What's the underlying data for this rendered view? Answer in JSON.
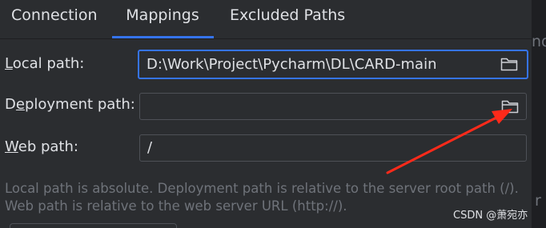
{
  "tabs": [
    {
      "label": "Connection"
    },
    {
      "label": "Mappings"
    },
    {
      "label": "Excluded Paths"
    }
  ],
  "active_tab": "Mappings",
  "form": {
    "local_path": {
      "label_mnemonic": "L",
      "label_rest": "ocal path:",
      "value": "D:\\Work\\Project\\Pycharm\\DL\\CARD-main"
    },
    "deployment_path": {
      "label_pre": "D",
      "label_mnemonic": "e",
      "label_rest": "ployment path:",
      "value": ""
    },
    "web_path": {
      "label_mnemonic": "W",
      "label_rest": "eb path:",
      "value": "/"
    }
  },
  "hints": [
    "Local path is absolute. Deployment path is relative to the server root path (/).",
    "Web path is relative to the web server URL (http://)."
  ],
  "edge_text": {
    "top": "nd",
    "bottom": "r"
  },
  "watermark": "CSDN @萧宛亦",
  "colors": {
    "background": "#2b2d30",
    "accent": "#3574f0",
    "annotation_arrow": "#ff2a1a",
    "text": "#dfe1e5",
    "hint_text": "#6f737a"
  },
  "icons": {
    "browse": "folder-icon"
  }
}
